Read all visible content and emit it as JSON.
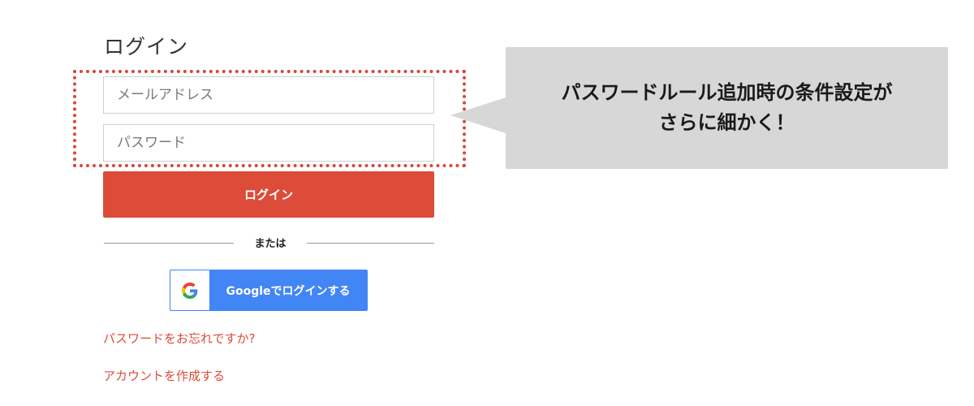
{
  "page": {
    "title": "ログイン"
  },
  "form": {
    "email_placeholder": "メールアドレス",
    "password_placeholder": "パスワード",
    "login_button": "ログイン",
    "divider_text": "または",
    "google_button": "Googleでログインする",
    "forgot_password_link": "パスワードをお忘れですか?",
    "create_account_link": "アカウントを作成する"
  },
  "callout": {
    "line1": "パスワードルール追加時の条件設定が",
    "line2": "さらに細かく！"
  },
  "colors": {
    "accent_red": "#dd4b39",
    "google_blue": "#4285f4",
    "callout_gray": "#d7d7d7"
  },
  "icons": {
    "google": "google-g-icon"
  }
}
